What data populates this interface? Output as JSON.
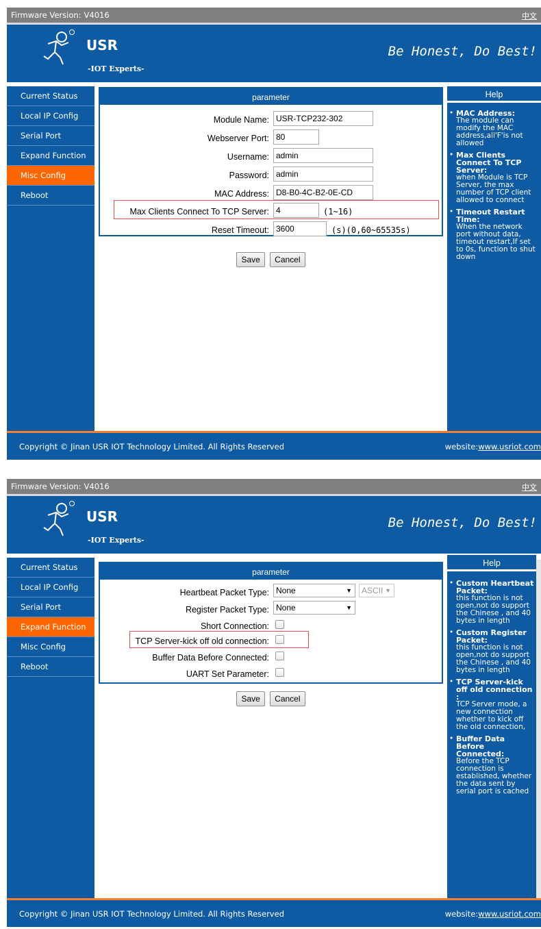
{
  "common": {
    "firmware_label": "Firmware Version:",
    "firmware_version": "V4016",
    "lang_link": "中文",
    "brand": "USR",
    "brand_sub": "-IOT Experts-",
    "slogan": "Be Honest, Do Best!",
    "help_title": "Help",
    "panel_title": "parameter",
    "save_label": "Save",
    "cancel_label": "Cancel",
    "copyright": "Copyright © Jinan USR IOT Technology Limited. All Rights Reserved",
    "website_label": "website:",
    "website_url": "www.usriot.com",
    "bullet": "•"
  },
  "nav": [
    "Current Status",
    "Local IP Config",
    "Serial Port",
    "Expand Function",
    "Misc Config",
    "Reboot"
  ],
  "screen1": {
    "active_nav": "Misc Config",
    "module_name_label": "Module Name:",
    "module_name_value": "USR-TCP232-302",
    "webserver_port_label": "Webserver Port:",
    "webserver_port_value": "80",
    "username_label": "Username:",
    "username_value": "admin",
    "password_label": "Password:",
    "password_value": "admin",
    "mac_label": "MAC Address:",
    "mac_value": "D8-B0-4C-B2-0E-CD",
    "max_clients_label": "Max Clients Connect To TCP Server:",
    "max_clients_value": "4",
    "max_clients_range": "(1~16)",
    "reset_timeout_label": "Reset Timeout:",
    "reset_timeout_value": "3600",
    "reset_timeout_unit": "(s)(0,60~65535s)",
    "help": [
      {
        "title": "MAC Address:",
        "desc": "The module can modify the MAC address,all'F'is not allowed"
      },
      {
        "title": "Max Clients Connect To TCP Server:",
        "desc": "when Module is TCP Server, the max number of TCP client allowed to connect"
      },
      {
        "title": "Timeout Restart Time:",
        "desc": "When the network port without data, timeout restart,If set to 0s, function to shut down"
      }
    ]
  },
  "screen2": {
    "active_nav": "Expand Function",
    "heartbeat_label": "Heartbeat Packet Type:",
    "heartbeat_value": "None",
    "heartbeat_format": "ASCII",
    "register_label": "Register Packet Type:",
    "register_value": "None",
    "short_conn_label": "Short Connection:",
    "kick_label": "TCP Server-kick off old connection:",
    "buffer_label": "Buffer Data Before Connected:",
    "uart_label": "UART Set Parameter:",
    "help": [
      {
        "title": "Custom Heartbeat Packet:",
        "desc": "this function is not open,not do support the Chinese , and 40 bytes in length"
      },
      {
        "title": "Custom Register Packet:",
        "desc": "this function is not open,not do support the Chinese , and 40 bytes in length"
      },
      {
        "title": "TCP Server-kick off old connection",
        "colon": ":",
        "desc": "TCP Server mode, a new connection whether to kick off the old connection,"
      },
      {
        "title": "Buffer Data Before Connected:",
        "desc": "Before the TCP connection is established, whether the data sent by serial port is cached"
      }
    ]
  },
  "colors": {
    "header_blue": "#0e5ba4",
    "active_orange": "#ff6600",
    "highlight_red": "#e74c4c"
  }
}
